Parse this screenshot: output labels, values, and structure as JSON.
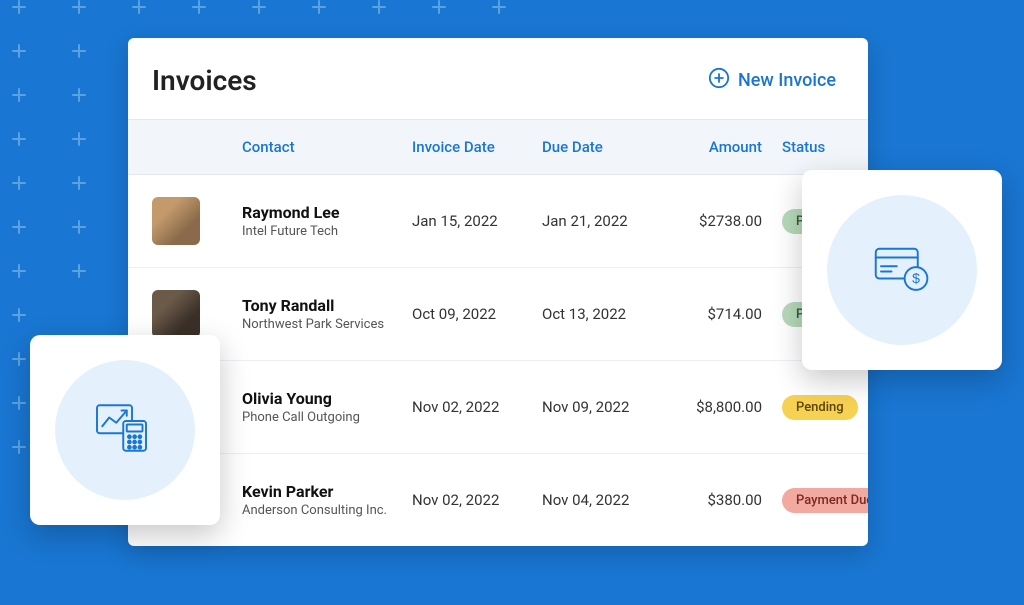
{
  "page": {
    "title": "Invoices",
    "newButton": "New Invoice"
  },
  "columns": {
    "contact": "Contact",
    "invoiceDate": "Invoice Date",
    "dueDate": "Due Date",
    "amount": "Amount",
    "status": "Status"
  },
  "rows": [
    {
      "name": "Raymond Lee",
      "company": "Intel Future Tech",
      "invoiceDate": "Jan 15, 2022",
      "dueDate": "Jan 21, 2022",
      "amount": "$2738.00",
      "status": "Paid",
      "statusClass": "paid"
    },
    {
      "name": "Tony Randall",
      "company": "Northwest Park Services",
      "invoiceDate": "Oct 09, 2022",
      "dueDate": "Oct 13, 2022",
      "amount": "$714.00",
      "status": "Paid",
      "statusClass": "paid"
    },
    {
      "name": "Olivia Young",
      "company": "Phone Call Outgoing",
      "invoiceDate": "Nov 02, 2022",
      "dueDate": "Nov 09, 2022",
      "amount": "$8,800.00",
      "status": "Pending",
      "statusClass": "pending"
    },
    {
      "name": "Kevin Parker",
      "company": "Anderson Consulting Inc.",
      "invoiceDate": "Nov 02, 2022",
      "dueDate": "Nov 04, 2022",
      "amount": "$380.00",
      "status": "Payment Due",
      "statusClass": "due"
    }
  ]
}
